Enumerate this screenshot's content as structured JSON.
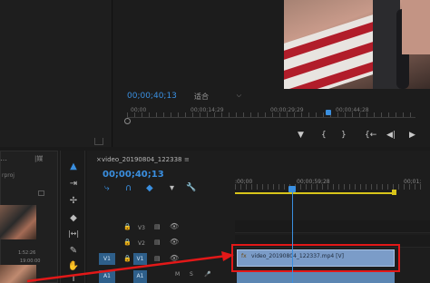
{
  "program_monitor": {
    "timecode": "00;00;40;13",
    "fit_label": "适合",
    "fit_chevron": "⌵",
    "ruler_labels": [
      "00;00",
      "00;00;14;29",
      "00;00;29;29",
      "00;00;44;28"
    ],
    "controls": {
      "marker": "▼",
      "mark_in": "{",
      "mark_out": "}",
      "go_to_in": "{←",
      "step_back": "◀|",
      "play": "▶"
    }
  },
  "project_panel": {
    "tab_label": "…",
    "tab2_label": "|媒",
    "text1": "rproj",
    "time1": "1:52:26",
    "time2": "19:00:00"
  },
  "tools": [
    "▲",
    "⇥",
    "✢",
    "◆",
    "|↔|",
    "✎",
    "✋",
    "T"
  ],
  "timeline": {
    "close_label": "×",
    "title": "video_20190804_122338",
    "menu_label": "≡",
    "timecode": "00;00;40;13",
    "buttons": [
      "⤷",
      "∩",
      "◆",
      "▾",
      "🔧"
    ],
    "ruler_labels": [
      ":00;00",
      "00;00;59;28",
      "00;01;"
    ],
    "tracks": [
      {
        "label": "V3",
        "lock": "🔒",
        "film": "▤",
        "eye": "👁"
      },
      {
        "label": "V2",
        "lock": "🔒",
        "film": "▤",
        "eye": "👁"
      },
      {
        "label": "V1",
        "lock": "🔒",
        "film": "▤",
        "eye": "👁"
      }
    ],
    "v1_target": "V1",
    "v1_label": "V1",
    "a1_target": "A1",
    "a1_label": "A1",
    "a1_controls": [
      "M",
      "S",
      "🎤"
    ],
    "clip": {
      "name": "video_20190804_122337.mp4 [V]",
      "fx": "fx"
    }
  },
  "colors": {
    "accent": "#3a8fe0",
    "clip": "#7b9cc8",
    "highlight": "#e21818",
    "work_area": "#d8c41a"
  }
}
